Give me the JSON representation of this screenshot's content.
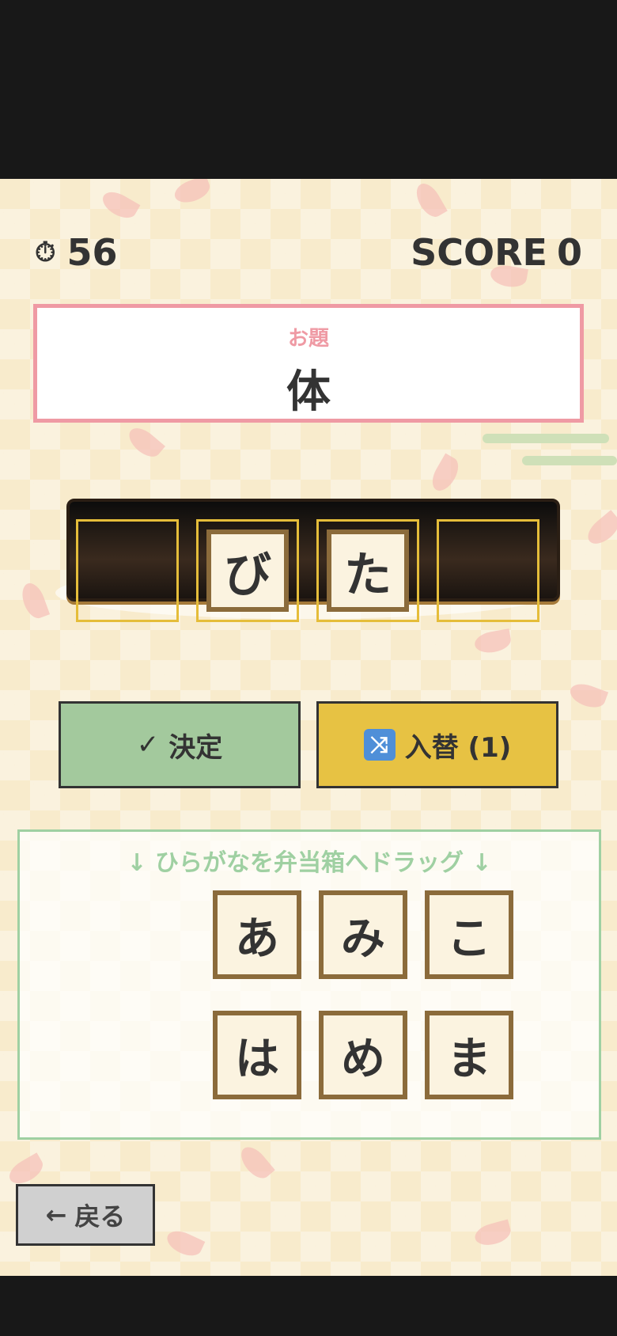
{
  "hud": {
    "timer_icon": "stopwatch-icon",
    "timer_value": "56",
    "score_label": "SCORE",
    "score_value": "0"
  },
  "prompt": {
    "label": "お題",
    "word": "体"
  },
  "bento_slots": [
    "",
    "び",
    "た",
    ""
  ],
  "buttons": {
    "decide_icon": "✓",
    "decide_label": "決定",
    "swap_icon": "shuffle-icon",
    "swap_label": "入替 (1)"
  },
  "tray": {
    "hint": "↓ ひらがなを弁当箱へドラッグ ↓",
    "tiles": [
      "あ",
      "み",
      "こ",
      "は",
      "め",
      "ま"
    ]
  },
  "back": {
    "arrow": "←",
    "label": "戻る"
  },
  "colors": {
    "accent_pink": "#ef9aa4",
    "decide_green": "#a3c99d",
    "swap_yellow": "#e7c243",
    "tray_green": "#9fd0a2"
  }
}
